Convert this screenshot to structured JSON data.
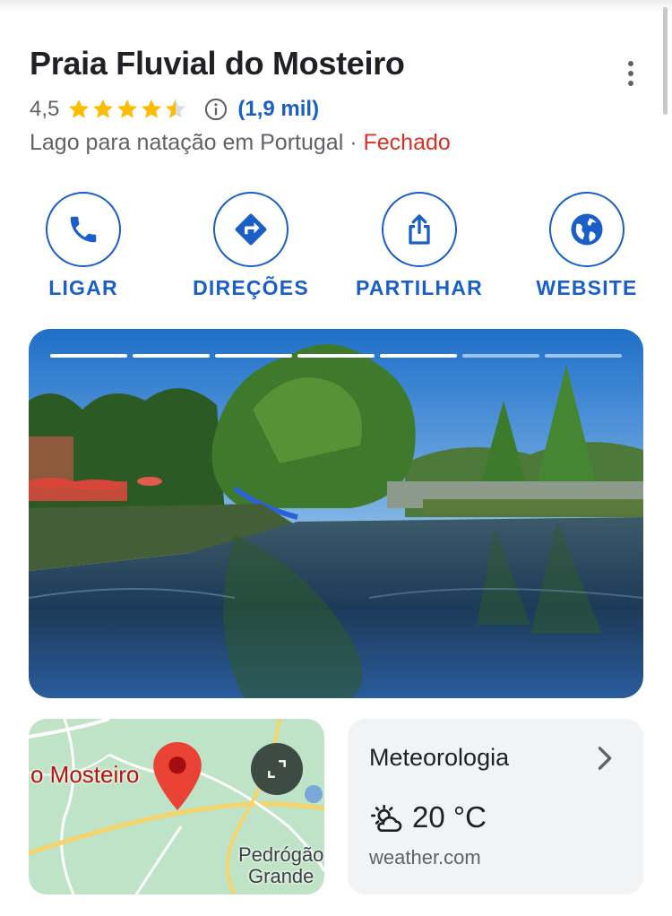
{
  "place": {
    "name": "Praia Fluvial do Mosteiro",
    "rating": "4,5",
    "rating_value": 4.5,
    "review_count": "(1,9 mil)",
    "category": "Lago para natação em Portugal",
    "separator": "·",
    "status": "Fechado"
  },
  "actions": [
    {
      "label": "LIGAR",
      "icon": "phone-icon"
    },
    {
      "label": "DIREÇÕES",
      "icon": "directions-icon"
    },
    {
      "label": "PARTILHAR",
      "icon": "share-icon"
    },
    {
      "label": "WEBSITE",
      "icon": "globe-icon"
    }
  ],
  "photo": {
    "total": 7,
    "viewed": 5
  },
  "map": {
    "place_label": "o Mosteiro",
    "town_line1": "Pedrógão",
    "town_line2": "Grande"
  },
  "weather": {
    "title": "Meteorologia",
    "temperature": "20 °C",
    "source": "weather.com",
    "icon": "partly-sunny-icon"
  },
  "colors": {
    "accent": "#1a5ec7",
    "star": "#fbbc04",
    "closed": "#d93025"
  }
}
